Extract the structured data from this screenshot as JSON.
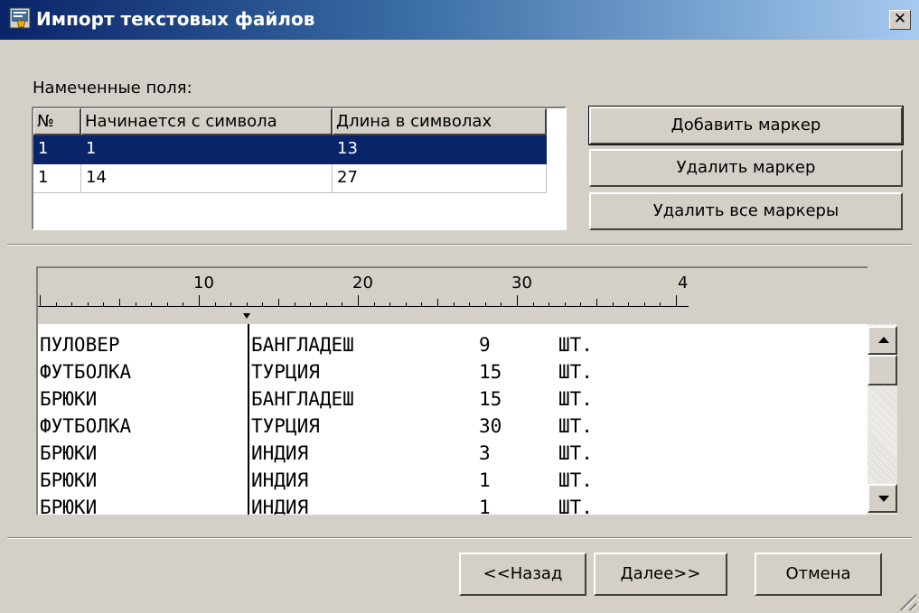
{
  "window": {
    "title": "Импорт текстовых файлов",
    "close_label": "✕"
  },
  "fields": {
    "label": "Намеченные поля:",
    "columns": [
      "№",
      "Начинается с символа",
      "Длина в символах"
    ],
    "rows": [
      [
        "1",
        "1",
        "13"
      ],
      [
        "1",
        "14",
        "27"
      ]
    ],
    "selected_row": 0
  },
  "buttons": {
    "add_marker": "Добавить маркер",
    "remove_marker": "Удалить маркер",
    "remove_all_markers": "Удалить все маркеры",
    "back": "<<Назад",
    "next": "Далее>>",
    "cancel": "Отмена"
  },
  "ruler": {
    "labels": [
      "10",
      "20",
      "30",
      "4"
    ]
  },
  "preview": {
    "rows": [
      [
        "ПУЛОВЕР",
        "БАНГЛАДЕШ",
        "9",
        "ШТ."
      ],
      [
        "ФУТБОЛКА",
        "ТУРЦИЯ",
        "15",
        "ШТ."
      ],
      [
        "БРЮКИ",
        "БАНГЛАДЕШ",
        "15",
        "ШТ."
      ],
      [
        "ФУТБОЛКА",
        "ТУРЦИЯ",
        "30",
        "ШТ."
      ],
      [
        "БРЮКИ",
        "ИНДИЯ",
        "3",
        "ШТ."
      ],
      [
        "БРЮКИ",
        "ИНДИЯ",
        "1",
        "ШТ."
      ],
      [
        "БРЮКИ",
        "ИНДИЯ",
        "1",
        "ШТ."
      ]
    ]
  }
}
